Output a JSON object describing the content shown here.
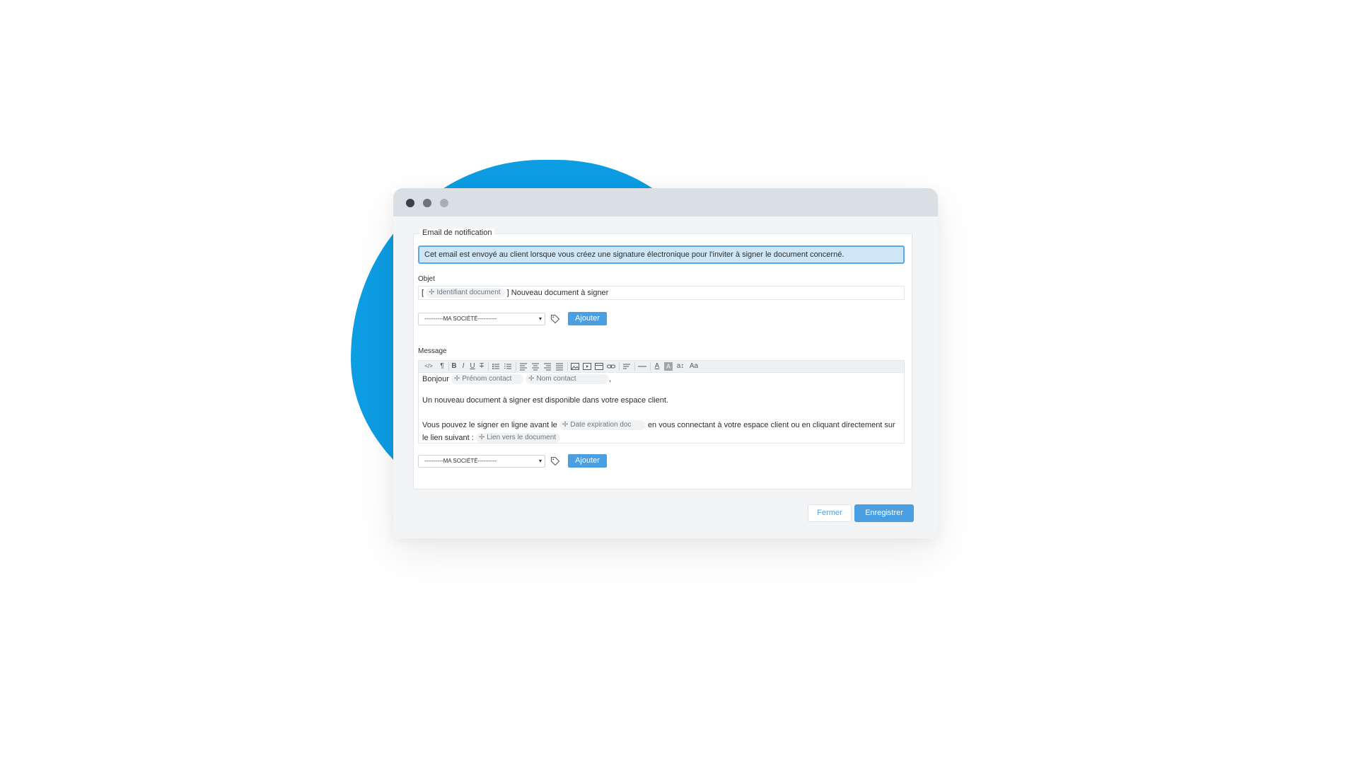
{
  "colors": {
    "accent": "#4a9fe2",
    "blob": "#0d9de3",
    "info_bg": "#cfe6f7",
    "info_border": "#5aa9e6"
  },
  "panel": {
    "legend": "Email de notification",
    "info": "Cet email est envoyé au client lorsque vous créez une signature électronique pour l'inviter à signer le document concerné.",
    "subject_label": "Objet",
    "subject": {
      "open_bracket": "[",
      "chip": "Identifiant document",
      "rest": "] Nouveau document à signer"
    },
    "select1": "----------MA SOCIÉTÉ----------",
    "add1": "Ajouter",
    "message_label": "Message",
    "editor": {
      "greeting": "Bonjour",
      "chip_firstname": "Prénom contact",
      "chip_lastname": "Nom contact",
      "comma": ",",
      "line2": "Un nouveau document à signer est disponible dans votre espace client.",
      "line3_start": "Vous pouvez le signer en ligne avant le",
      "chip_date": "Date expiration doc",
      "line3_end": "en vous connectant à votre espace client ou en cliquant directement sur",
      "line4_start": "le lien suivant :",
      "chip_link": "Lien vers le document"
    },
    "select2": "----------MA SOCIÉTÉ----------",
    "add2": "Ajouter"
  },
  "toolbar": {
    "code": "</>",
    "paragraph": "¶",
    "bold": "B",
    "italic": "I",
    "underline": "U",
    "strike": "T",
    "font_color": "A",
    "bg_color": "A",
    "font_size": "a↕",
    "font_family": "Aa"
  },
  "footer": {
    "close": "Fermer",
    "save": "Enregistrer"
  }
}
